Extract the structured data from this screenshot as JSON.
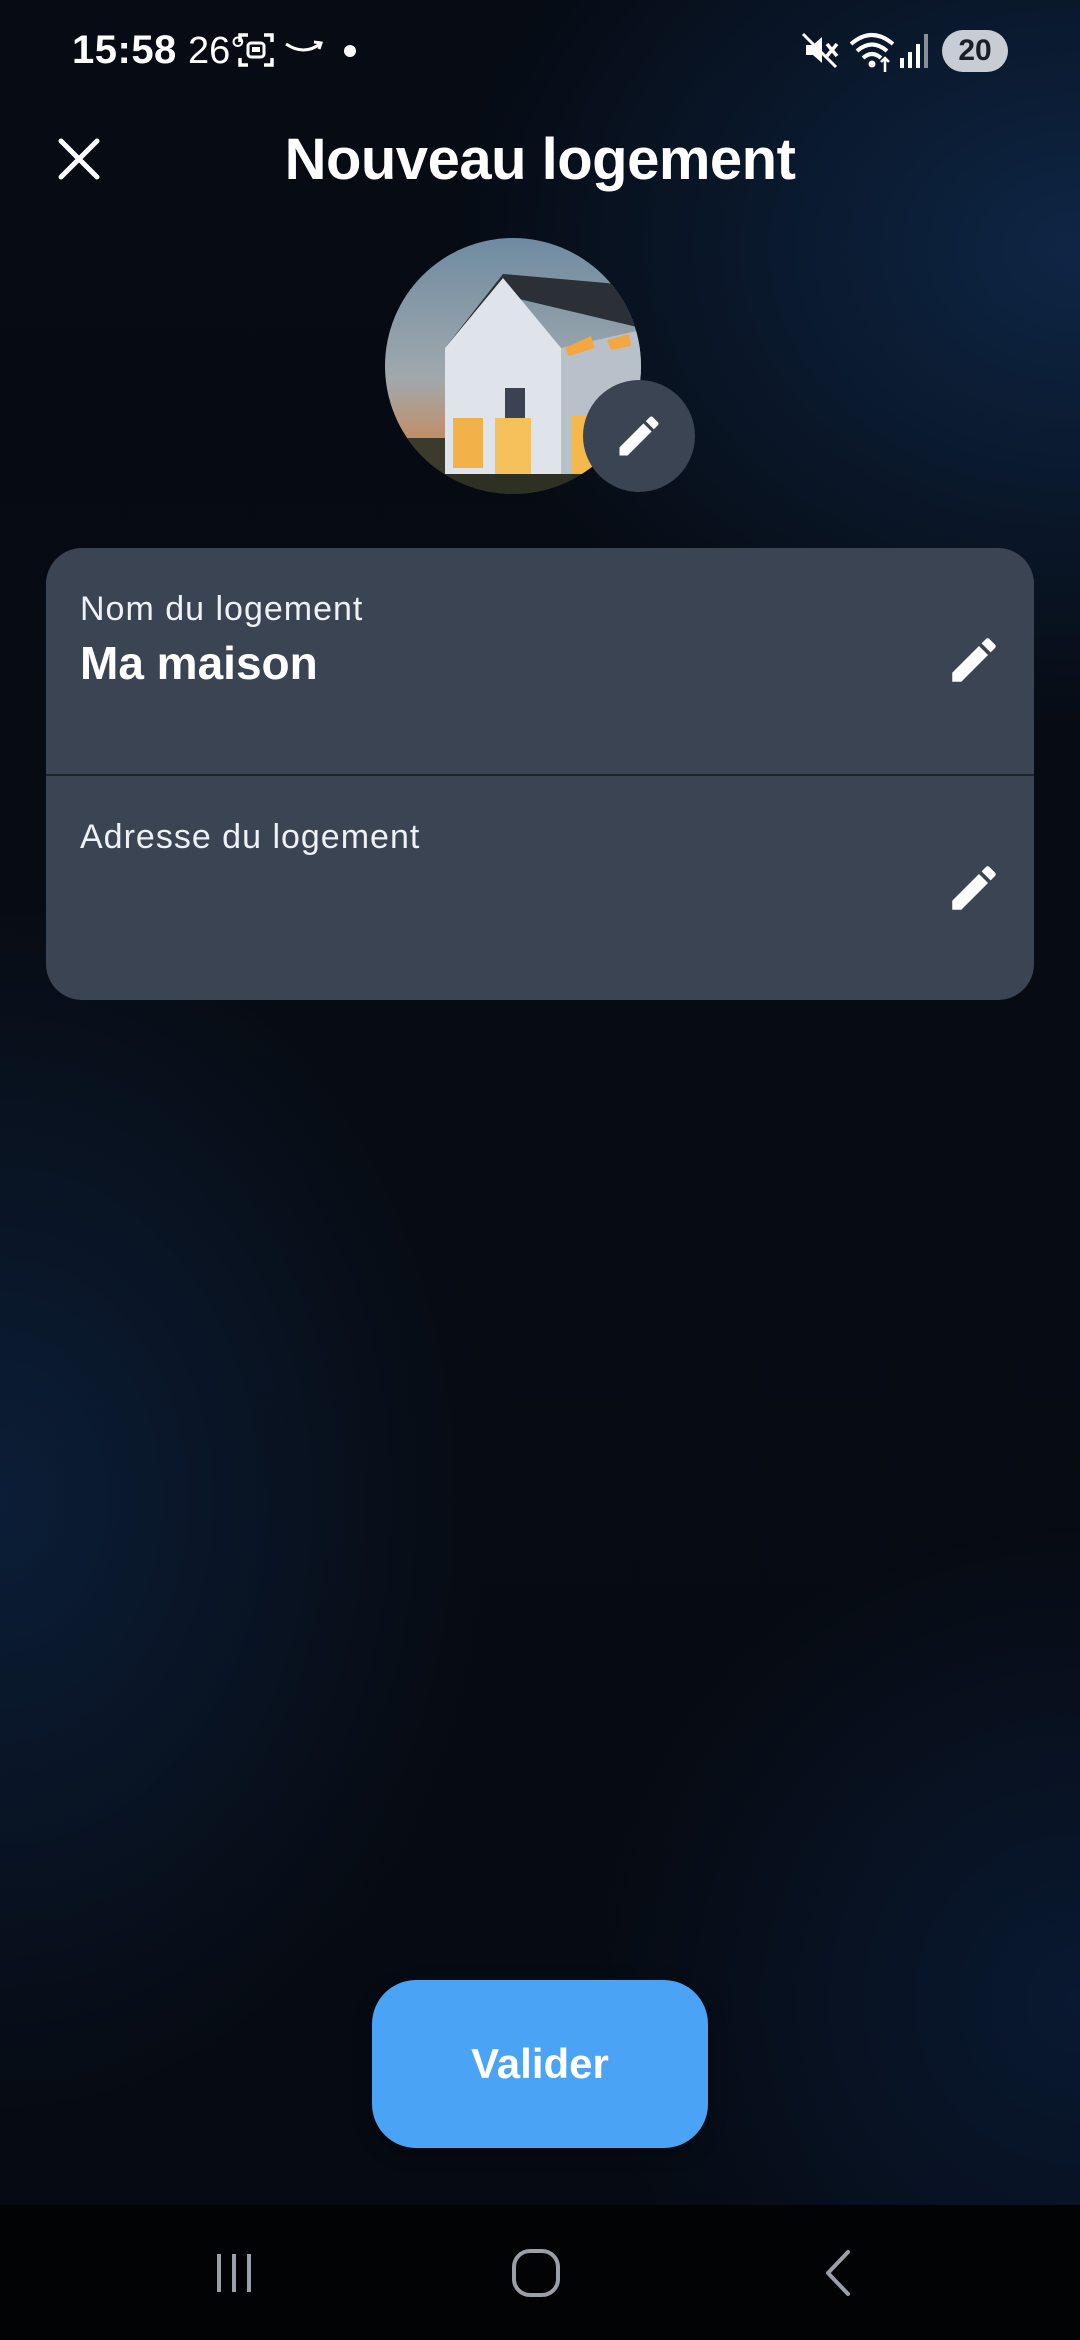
{
  "status_bar": {
    "time": "15:58",
    "temperature": "26°",
    "battery": "20",
    "icons": [
      "screenshot-icon",
      "amazon-icon",
      "dot-icon",
      "mute-icon",
      "wifi-icon",
      "signal-icon"
    ]
  },
  "header": {
    "title": "Nouveau logement",
    "close_icon": "close-icon"
  },
  "avatar": {
    "image": "house-photo",
    "edit_icon": "pencil-icon"
  },
  "form": {
    "name_label": "Nom du logement",
    "name_value": "Ma maison",
    "address_label": "Adresse du logement",
    "address_value": ""
  },
  "actions": {
    "validate_label": "Valider"
  },
  "colors": {
    "accent": "#4aa3f5",
    "card": "#3b4452",
    "background": "#070b12"
  },
  "nav": {
    "icons": [
      "recents-icon",
      "home-icon",
      "back-icon"
    ]
  }
}
